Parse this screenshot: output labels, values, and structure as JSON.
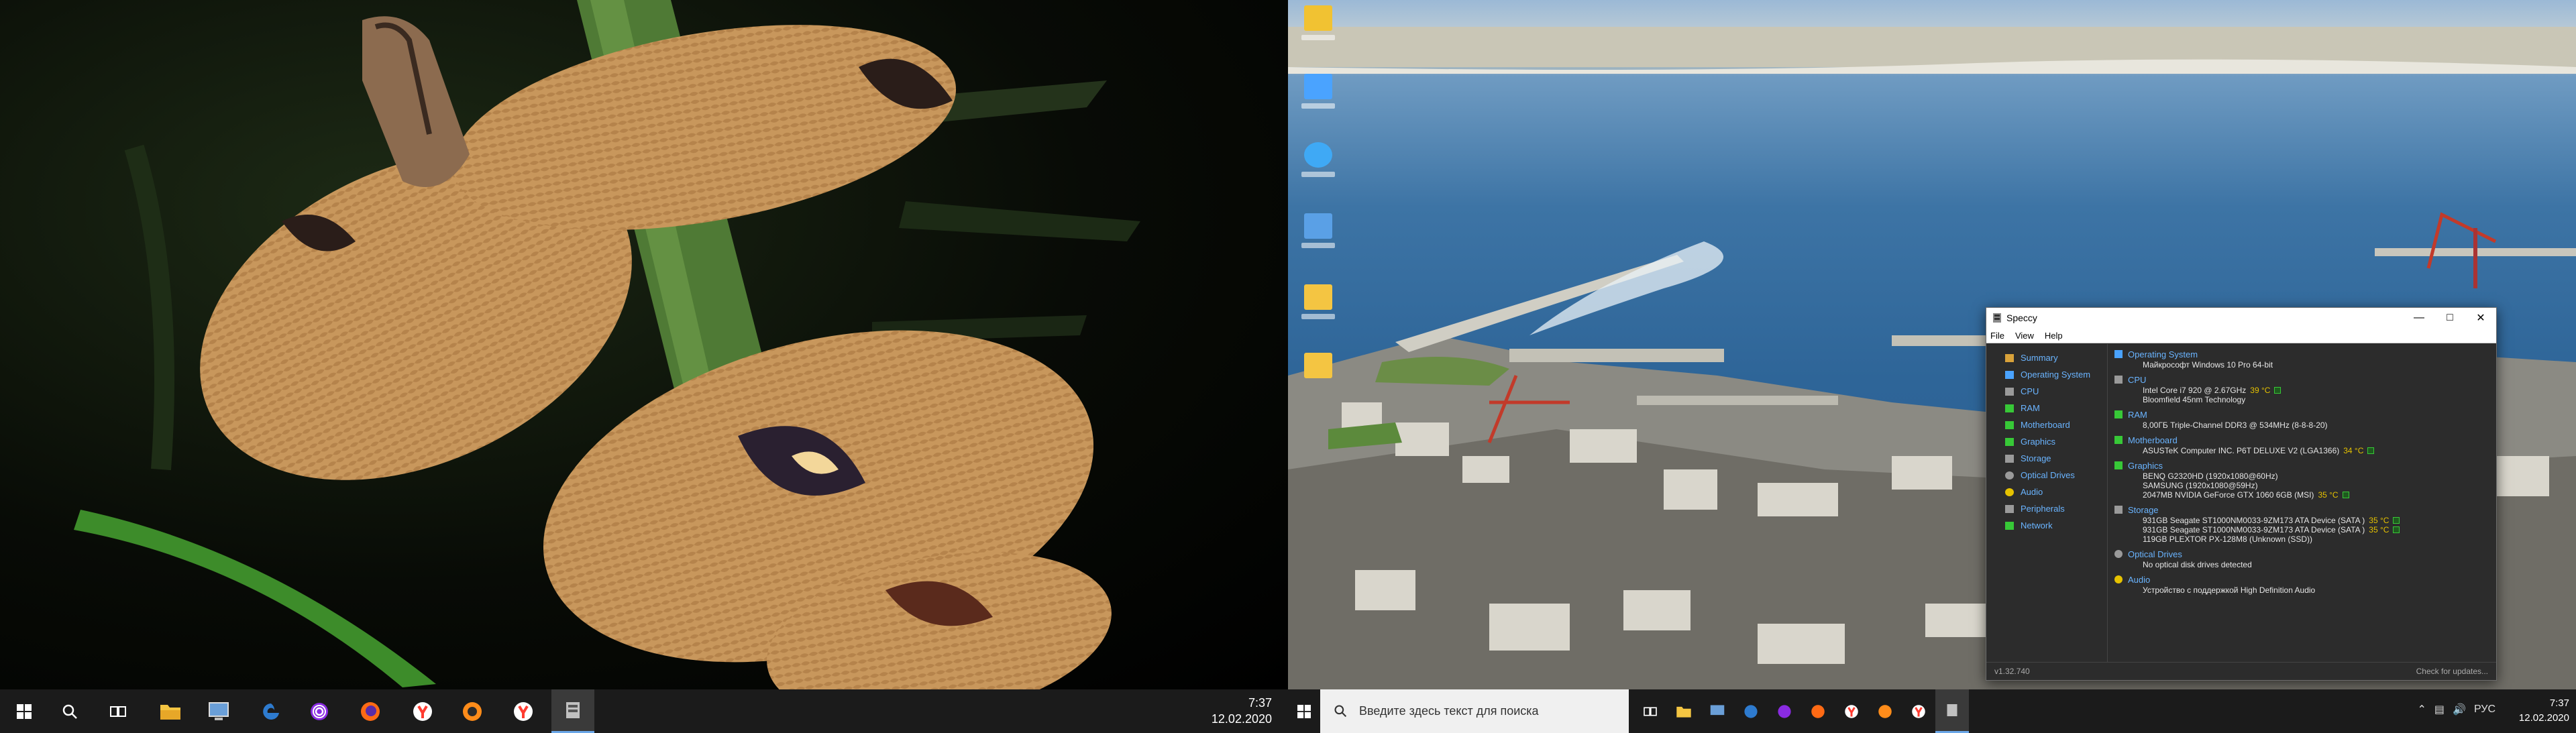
{
  "left_taskbar": {
    "clock_time": "7:37",
    "clock_date": "12.02.2020",
    "apps": [
      {
        "icon": "windows-start-icon",
        "color": "#ffffff"
      },
      {
        "icon": "search-icon",
        "color": "#ffffff"
      },
      {
        "icon": "task-view-icon",
        "color": "#ffffff"
      },
      {
        "icon": "file-explorer-icon",
        "color": "#f4c542"
      },
      {
        "icon": "desktop-app-icon",
        "color": "#6a9fd8"
      },
      {
        "icon": "edge-icon",
        "color": "#2e7bcf"
      },
      {
        "icon": "podcast-app-icon",
        "color": "#8a2be2"
      },
      {
        "icon": "firefox-icon",
        "color": "#ff6a14"
      },
      {
        "icon": "yandex-browser-icon",
        "color": "#ff3b30"
      },
      {
        "icon": "firefox-dev-icon",
        "color": "#ff8c1a"
      },
      {
        "icon": "yandex-browser-alt-icon",
        "color": "#ff3b30"
      },
      {
        "icon": "speccy-app-icon",
        "color": "#c0c0c0"
      }
    ]
  },
  "right_taskbar": {
    "search_placeholder": "Введите здесь текст для поиска",
    "clock_time": "7:37",
    "clock_date": "12.02.2020",
    "language": "РУС"
  },
  "desktop_icons": [
    {
      "icon": "user-folder-icon",
      "color": "#f1c232"
    },
    {
      "icon": "this-pc-icon",
      "color": "#4aa3ff"
    },
    {
      "icon": "network-globe-icon",
      "color": "#3fa9f5"
    },
    {
      "icon": "control-panel-icon",
      "color": "#5aa0e6"
    },
    {
      "icon": "folder-icon",
      "color": "#f4c542"
    },
    {
      "icon": "folder-icon",
      "color": "#f4c542"
    }
  ],
  "speccy": {
    "title": "Speccy",
    "menu": [
      "File",
      "View",
      "Help"
    ],
    "nav": [
      {
        "label": "Summary",
        "color": "#d9a23a"
      },
      {
        "label": "Operating System",
        "color": "#4aa3ff"
      },
      {
        "label": "CPU",
        "color": "#9a9a9a"
      },
      {
        "label": "RAM",
        "color": "#37c837"
      },
      {
        "label": "Motherboard",
        "color": "#37c837"
      },
      {
        "label": "Graphics",
        "color": "#37c837"
      },
      {
        "label": "Storage",
        "color": "#9a9a9a"
      },
      {
        "label": "Optical Drives",
        "color": "#9a9a9a"
      },
      {
        "label": "Audio",
        "color": "#e6c200"
      },
      {
        "label": "Peripherals",
        "color": "#9a9a9a"
      },
      {
        "label": "Network",
        "color": "#37c837"
      }
    ],
    "sections": [
      {
        "title": "Operating System",
        "icon_color": "#4aa3ff",
        "lines": [
          {
            "text": "Майкрософт Windows 10 Pro 64-bit",
            "temp": ""
          }
        ]
      },
      {
        "title": "CPU",
        "icon_color": "#9a9a9a",
        "lines": [
          {
            "text": "Intel Core i7 920 @ 2.67GHz",
            "temp": "39 °C"
          },
          {
            "text": "Bloomfield 45nm Technology",
            "temp": ""
          }
        ]
      },
      {
        "title": "RAM",
        "icon_color": "#37c837",
        "lines": [
          {
            "text": "8,00ГБ Triple-Channel DDR3 @ 534MHz (8-8-8-20)",
            "temp": ""
          }
        ]
      },
      {
        "title": "Motherboard",
        "icon_color": "#37c837",
        "lines": [
          {
            "text": "ASUSTeK Computer INC. P6T DELUXE V2 (LGA1366)",
            "temp": "34 °C"
          }
        ]
      },
      {
        "title": "Graphics",
        "icon_color": "#37c837",
        "lines": [
          {
            "text": "BENQ G2320HD (1920x1080@60Hz)",
            "temp": ""
          },
          {
            "text": "SAMSUNG (1920x1080@59Hz)",
            "temp": ""
          },
          {
            "text": "2047MB NVIDIA GeForce GTX 1060 6GB (MSI)",
            "temp": "35 °C"
          }
        ]
      },
      {
        "title": "Storage",
        "icon_color": "#9a9a9a",
        "lines": [
          {
            "text": "931GB Seagate ST1000NM0033-9ZM173 ATA Device (SATA )",
            "temp": "35 °C"
          },
          {
            "text": "931GB Seagate ST1000NM0033-9ZM173 ATA Device (SATA )",
            "temp": "35 °C"
          },
          {
            "text": "119GB PLEXTOR PX-128M8 (Unknown (SSD))",
            "temp": ""
          }
        ]
      },
      {
        "title": "Optical Drives",
        "icon_color": "#9a9a9a",
        "lines": [
          {
            "text": "No optical disk drives detected",
            "temp": ""
          }
        ]
      },
      {
        "title": "Audio",
        "icon_color": "#e6c200",
        "lines": [
          {
            "text": "Устройство с поддержкой High Definition Audio",
            "temp": ""
          }
        ]
      }
    ],
    "version": "v1.32.740",
    "check_updates": "Check for updates..."
  }
}
